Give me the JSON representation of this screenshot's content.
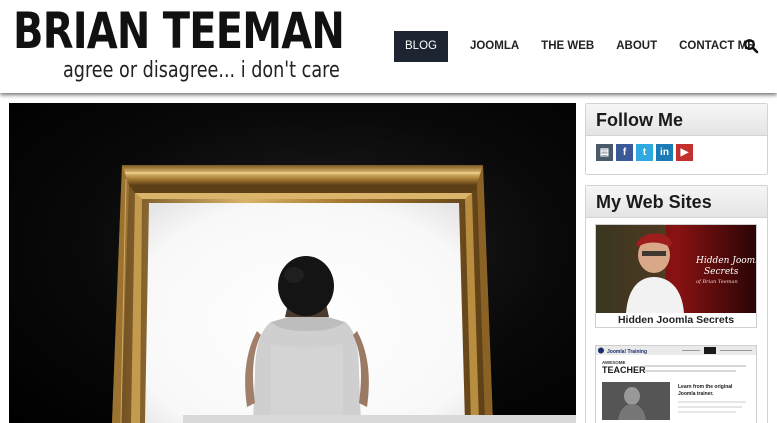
{
  "site": {
    "name": "BRIAN TEEMAN",
    "tagline": "agree or disagree... i don't care"
  },
  "nav": {
    "items": [
      {
        "label": "BLOG",
        "active": true
      },
      {
        "label": "JOOMLA",
        "active": false
      },
      {
        "label": "THE WEB",
        "active": false
      },
      {
        "label": "ABOUT",
        "active": false
      },
      {
        "label": "CONTACT ME",
        "active": false
      }
    ],
    "search_icon": "search-icon"
  },
  "hero": {
    "image": "woman-looking-at-empty-golden-frame"
  },
  "sidebar": {
    "follow": {
      "title": "Follow Me",
      "icons": [
        {
          "name": "blog-icon",
          "glyph": "▤",
          "color": "#4a5a6a"
        },
        {
          "name": "facebook-icon",
          "glyph": "f",
          "color": "#3b5998"
        },
        {
          "name": "twitter-icon",
          "glyph": "t",
          "color": "#2fa9e0"
        },
        {
          "name": "linkedin-icon",
          "glyph": "in",
          "color": "#1b7bb5"
        },
        {
          "name": "youtube-icon",
          "glyph": "▶",
          "color": "#c4302b"
        }
      ]
    },
    "sites": {
      "title": "My Web Sites",
      "cards": [
        {
          "caption": "Hidden Joomla Secrets",
          "image_text": "Hidden Joomla! Secrets",
          "image_subtext": "of Brian Teeman"
        },
        {
          "header_text": "Joomla! Training",
          "heading_small": "AWESOME",
          "heading": "TEACHER",
          "promo": "Learn from the original Joomla trainer."
        }
      ]
    }
  },
  "colors": {
    "nav_active_bg": "#1d2533",
    "frame_gold": "#c29a4a"
  }
}
